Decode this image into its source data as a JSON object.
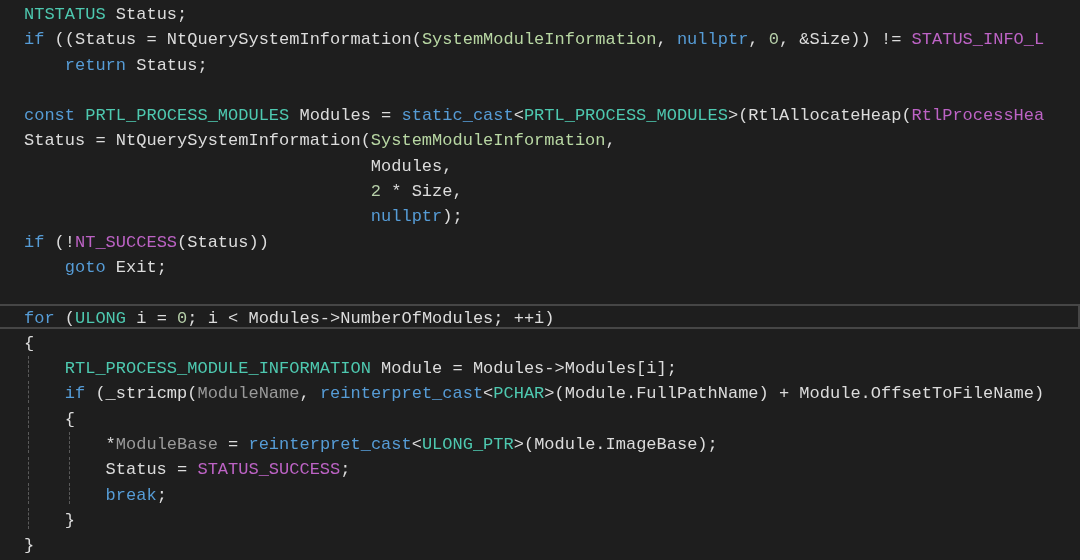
{
  "editor": {
    "lines": [
      {
        "kind": "code",
        "tokens": [
          {
            "kind": "type",
            "text": "NTSTATUS"
          },
          {
            "kind": "plain",
            "text": " Status;"
          }
        ]
      },
      {
        "kind": "code",
        "tokens": [
          {
            "kind": "keyword",
            "text": "if"
          },
          {
            "kind": "plain",
            "text": " ((Status = NtQuerySystemInformation("
          },
          {
            "kind": "enum",
            "text": "SystemModuleInformation"
          },
          {
            "kind": "plain",
            "text": ", "
          },
          {
            "kind": "keyword",
            "text": "nullptr"
          },
          {
            "kind": "plain",
            "text": ", "
          },
          {
            "kind": "number",
            "text": "0"
          },
          {
            "kind": "plain",
            "text": ", &Size)) != "
          },
          {
            "kind": "macro",
            "text": "STATUS_INFO_L"
          }
        ]
      },
      {
        "kind": "code",
        "tokens": [
          {
            "kind": "keyword",
            "text": "    return"
          },
          {
            "kind": "plain",
            "text": " Status;"
          }
        ]
      },
      {
        "kind": "blank"
      },
      {
        "kind": "code",
        "tokens": [
          {
            "kind": "keyword",
            "text": "const "
          },
          {
            "kind": "type",
            "text": "PRTL_PROCESS_MODULES"
          },
          {
            "kind": "plain",
            "text": " Modules = "
          },
          {
            "kind": "keyword",
            "text": "static_cast"
          },
          {
            "kind": "plain",
            "text": "<"
          },
          {
            "kind": "type",
            "text": "PRTL_PROCESS_MODULES"
          },
          {
            "kind": "plain",
            "text": ">(RtlAllocateHeap("
          },
          {
            "kind": "macro",
            "text": "RtlProcessHea"
          }
        ]
      },
      {
        "kind": "code",
        "tokens": [
          {
            "kind": "plain",
            "text": "Status = NtQuerySystemInformation("
          },
          {
            "kind": "enum",
            "text": "SystemModuleInformation"
          },
          {
            "kind": "plain",
            "text": ","
          }
        ]
      },
      {
        "kind": "code",
        "tokens": [
          {
            "kind": "plain",
            "text": "                                  Modules,"
          }
        ]
      },
      {
        "kind": "code",
        "tokens": [
          {
            "kind": "number",
            "text": "                                  2"
          },
          {
            "kind": "plain",
            "text": " * Size,"
          }
        ]
      },
      {
        "kind": "code",
        "tokens": [
          {
            "kind": "keyword",
            "text": "                                  nullptr"
          },
          {
            "kind": "plain",
            "text": ");"
          }
        ]
      },
      {
        "kind": "code",
        "tokens": [
          {
            "kind": "keyword",
            "text": "if"
          },
          {
            "kind": "plain",
            "text": " (!"
          },
          {
            "kind": "macro",
            "text": "NT_SUCCESS"
          },
          {
            "kind": "plain",
            "text": "(Status))"
          }
        ]
      },
      {
        "kind": "code",
        "tokens": [
          {
            "kind": "keyword",
            "text": "    goto"
          },
          {
            "kind": "plain",
            "text": " Exit;"
          }
        ]
      },
      {
        "kind": "blank"
      },
      {
        "kind": "code",
        "current": true,
        "tokens": [
          {
            "kind": "keyword",
            "text": "for"
          },
          {
            "kind": "plain",
            "text": " ("
          },
          {
            "kind": "type",
            "text": "ULONG"
          },
          {
            "kind": "plain",
            "text": " i = "
          },
          {
            "kind": "number",
            "text": "0"
          },
          {
            "kind": "plain",
            "text": "; i < Modules->NumberOfModules; ++i)"
          }
        ]
      },
      {
        "kind": "block-open",
        "tokens": [
          {
            "kind": "plain",
            "text": "{"
          }
        ]
      },
      {
        "kind": "code",
        "tokens": [
          {
            "kind": "type",
            "text": "    RTL_PROCESS_MODULE_INFORMATION"
          },
          {
            "kind": "plain",
            "text": " Module = Modules->Modules[i];"
          }
        ]
      },
      {
        "kind": "code",
        "tokens": [
          {
            "kind": "keyword",
            "text": "    if"
          },
          {
            "kind": "plain",
            "text": " (_stricmp("
          },
          {
            "kind": "param",
            "text": "ModuleName"
          },
          {
            "kind": "plain",
            "text": ", "
          },
          {
            "kind": "keyword",
            "text": "reinterpret_cast"
          },
          {
            "kind": "plain",
            "text": "<"
          },
          {
            "kind": "type",
            "text": "PCHAR"
          },
          {
            "kind": "plain",
            "text": ">(Module.FullPathName) + Module.OffsetToFileName)"
          }
        ]
      },
      {
        "kind": "block-open",
        "tokens": [
          {
            "kind": "plain",
            "text": "    {"
          }
        ]
      },
      {
        "kind": "code",
        "tokens": [
          {
            "kind": "plain",
            "text": "        *"
          },
          {
            "kind": "param",
            "text": "ModuleBase"
          },
          {
            "kind": "plain",
            "text": " = "
          },
          {
            "kind": "keyword",
            "text": "reinterpret_cast"
          },
          {
            "kind": "plain",
            "text": "<"
          },
          {
            "kind": "type",
            "text": "ULONG_PTR"
          },
          {
            "kind": "plain",
            "text": ">(Module.ImageBase);"
          }
        ]
      },
      {
        "kind": "code",
        "tokens": [
          {
            "kind": "plain",
            "text": "        Status = "
          },
          {
            "kind": "macro",
            "text": "STATUS_SUCCESS"
          },
          {
            "kind": "plain",
            "text": ";"
          }
        ]
      },
      {
        "kind": "code",
        "tokens": [
          {
            "kind": "keyword",
            "text": "        break"
          },
          {
            "kind": "plain",
            "text": ";"
          }
        ]
      },
      {
        "kind": "block-close",
        "tokens": [
          {
            "kind": "plain",
            "text": "    }"
          }
        ]
      },
      {
        "kind": "block-close",
        "tokens": [
          {
            "kind": "plain",
            "text": "}"
          }
        ]
      }
    ]
  }
}
